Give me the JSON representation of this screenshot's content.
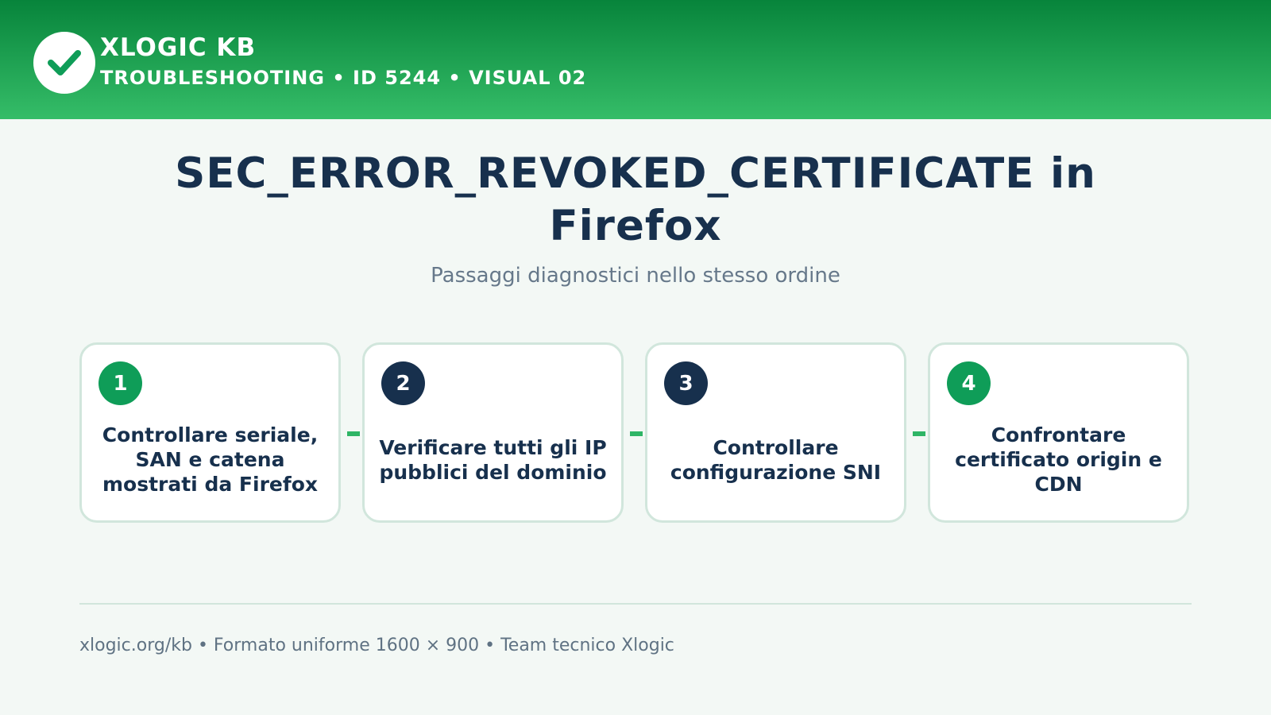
{
  "header": {
    "brand": "XLOGIC KB",
    "subtitle": "TROUBLESHOOTING • ID 5244 • VISUAL 02",
    "logo_icon": "check-icon"
  },
  "title": "SEC_ERROR_REVOKED_CERTIFICATE in Firefox",
  "subtitle": "Passaggi diagnostici nello stesso ordine",
  "steps": [
    {
      "number": "1",
      "text": "Controllare seriale, SAN e catena mostrati da Firefox",
      "badge_color": "#0f9d58"
    },
    {
      "number": "2",
      "text": "Verificare tutti gli IP pubblici del dominio",
      "badge_color": "#17304d"
    },
    {
      "number": "3",
      "text": "Controllare configurazione SNI",
      "badge_color": "#17304d"
    },
    {
      "number": "4",
      "text": "Confrontare certificato origin e CDN",
      "badge_color": "#0f9d58"
    }
  ],
  "footer": "xlogic.org/kb • Formato uniforme 1600 × 900 • Team tecnico Xlogic",
  "colors": {
    "header_top": "#07843b",
    "header_bottom": "#35bd68",
    "navy": "#17304d",
    "green": "#0f9d58",
    "connector": "#2fb566"
  }
}
